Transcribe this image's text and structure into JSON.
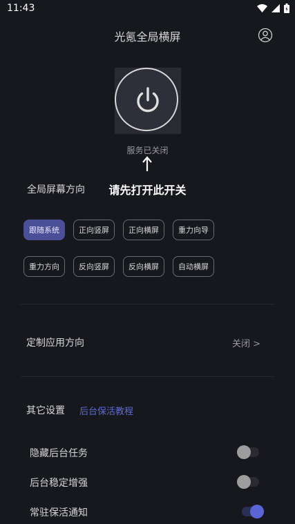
{
  "status_bar": {
    "time": "11:43"
  },
  "header": {
    "title": "光氪全局横屏"
  },
  "service": {
    "status": "服务已关闭",
    "hint": "请先打开此开关"
  },
  "orientation": {
    "label": "全局屏幕方向",
    "options": [
      "跟随系统",
      "正向竖屏",
      "正向横屏",
      "重力向导",
      "重力方向",
      "反向竖屏",
      "反向横屏",
      "自动横屏"
    ],
    "selected": "跟随系统"
  },
  "custom_app": {
    "label": "定制应用方向",
    "value": "关闭 >"
  },
  "other_settings": {
    "label": "其它设置",
    "link": "后台保活教程"
  },
  "toggles": [
    {
      "label": "隐藏后台任务",
      "state": "off"
    },
    {
      "label": "后台稳定增强",
      "state": "off"
    },
    {
      "label": "常驻保活通知",
      "state": "on"
    }
  ],
  "colors": {
    "accent": "#5965d5",
    "selected_button": "#4a4f97",
    "background": "#17181d"
  }
}
